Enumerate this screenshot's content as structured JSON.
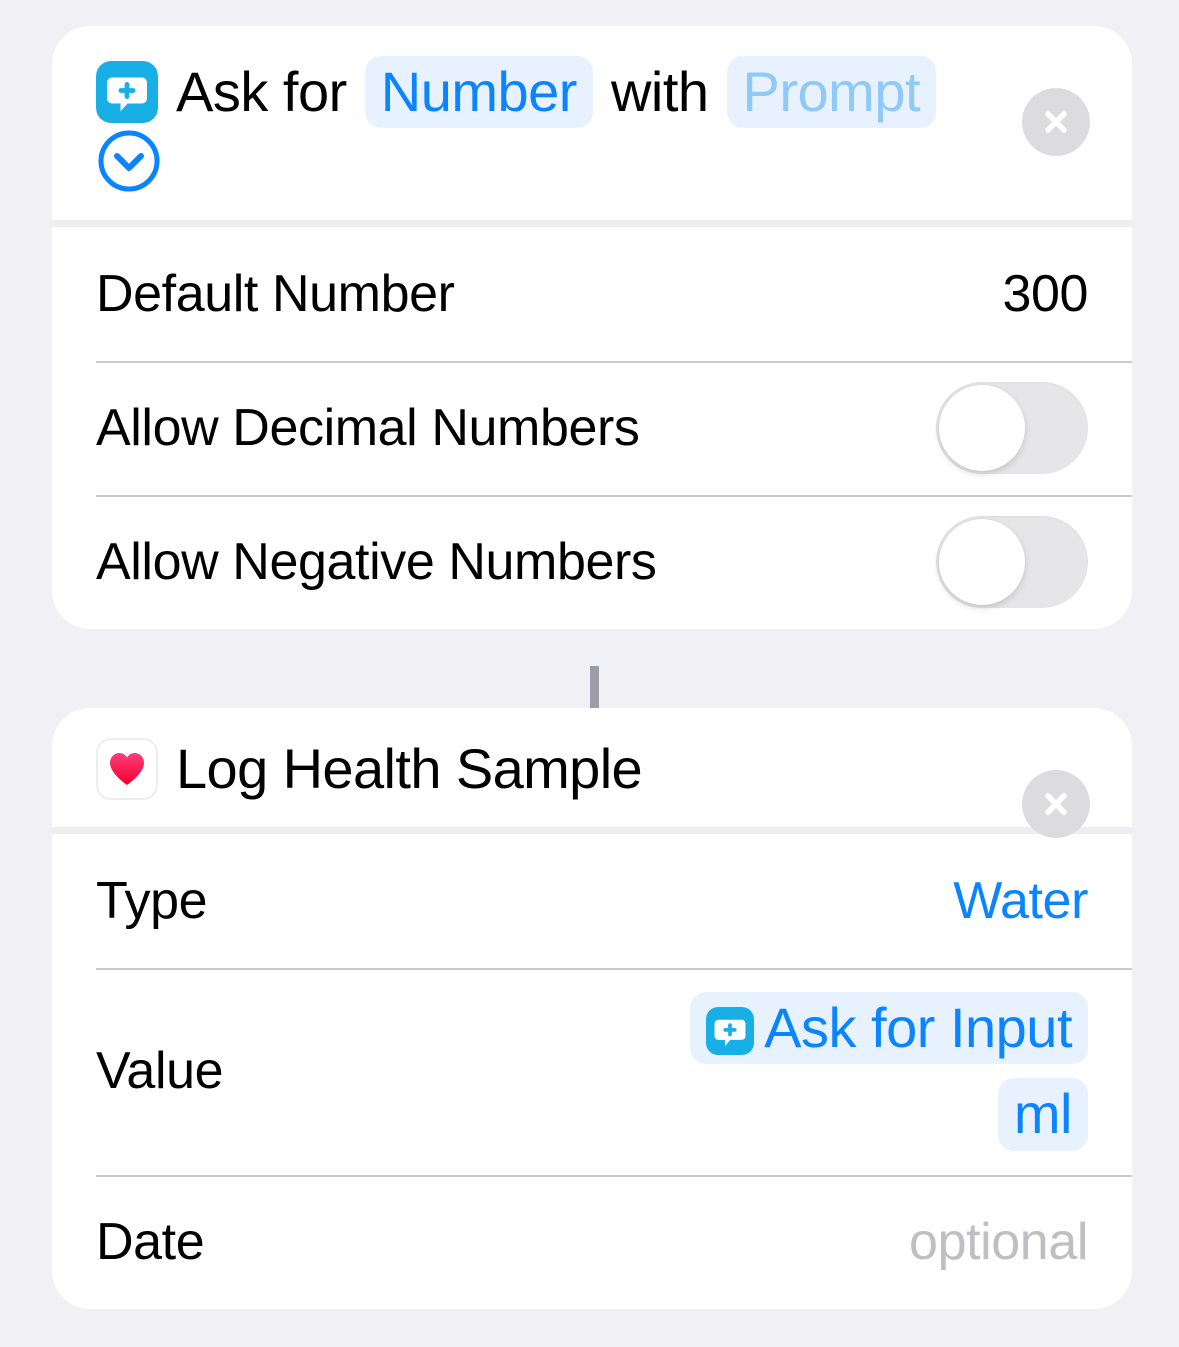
{
  "theme": {
    "page_background": "#F1F1F5",
    "card_background": "#FFFFFF",
    "accent_blue": "#0A84FF",
    "token_pill_background": "#E8F2FE",
    "placeholder_blue": "#8FC9F8",
    "muted_gray": "#BFBFC3",
    "separator_gray": "#C9C9CC",
    "header_divider_gray": "#EDEDF1",
    "close_button_gray": "#DCDCDE",
    "ask_icon_cyan": "#18AEE6",
    "heart_pink": "#FC3C7E",
    "heart_red": "#F5002A",
    "toggle_off_track": "#E6E6E8",
    "connector_gray": "#9B9DA8"
  },
  "actions": [
    {
      "id": "ask-for-input",
      "icon_name": "ask-for-input-icon",
      "header_segments": [
        {
          "kind": "text",
          "label": "Ask for"
        },
        {
          "kind": "token",
          "label": "Number"
        },
        {
          "kind": "text",
          "label": "with"
        },
        {
          "kind": "token_placeholder",
          "label": "Prompt"
        },
        {
          "kind": "chevron",
          "label": "chevron-down-circle-icon"
        }
      ],
      "close_label": "×",
      "rows": [
        {
          "id": "default-number",
          "label": "Default Number",
          "value": "300",
          "kind": "value"
        },
        {
          "id": "allow-decimal",
          "label": "Allow Decimal Numbers",
          "value": "off",
          "kind": "toggle"
        },
        {
          "id": "allow-negative",
          "label": "Allow Negative Numbers",
          "value": "off",
          "kind": "toggle"
        }
      ]
    },
    {
      "id": "log-health-sample",
      "icon_name": "health-heart-icon",
      "title": "Log Health Sample",
      "close_label": "×",
      "rows": [
        {
          "id": "type",
          "label": "Type",
          "value": "Water",
          "kind": "accent"
        },
        {
          "id": "value",
          "label": "Value",
          "kind": "tokens",
          "tokens": [
            {
              "label": "Ask for Input",
              "icon_name": "ask-for-input-icon",
              "has_icon": true
            },
            {
              "label": "ml",
              "has_icon": false
            }
          ]
        },
        {
          "id": "date",
          "label": "Date",
          "value": "optional",
          "kind": "muted"
        }
      ]
    }
  ]
}
